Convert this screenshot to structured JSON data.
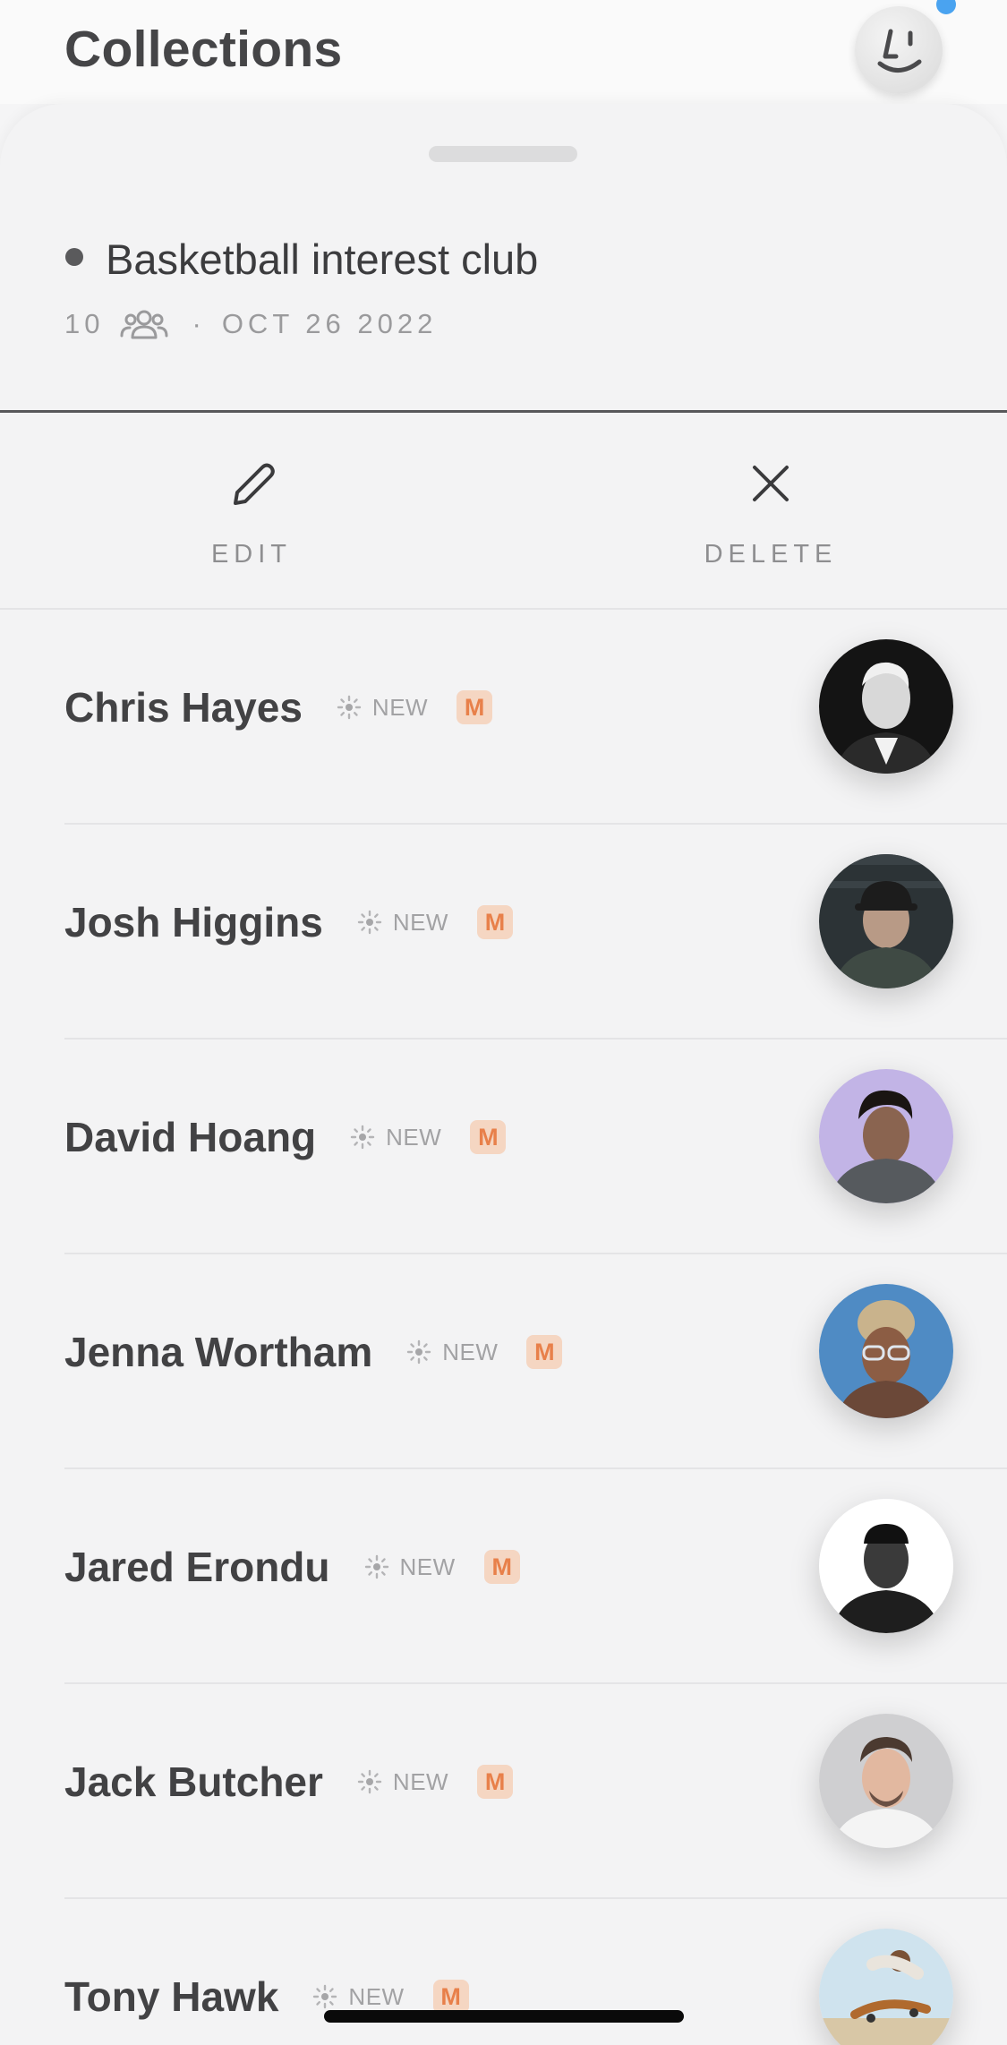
{
  "header": {
    "title": "Collections"
  },
  "collection": {
    "name": "Basketball interest club",
    "member_count": "10",
    "separator": "·",
    "date": "OCT 26 2022"
  },
  "actions": {
    "edit_label": "EDIT",
    "delete_label": "DELETE"
  },
  "people": [
    {
      "name": "Chris Hayes",
      "status": "NEW",
      "badge": "M"
    },
    {
      "name": "Josh Higgins",
      "status": "NEW",
      "badge": "M"
    },
    {
      "name": "David Hoang",
      "status": "NEW",
      "badge": "M"
    },
    {
      "name": "Jenna Wortham",
      "status": "NEW",
      "badge": "M"
    },
    {
      "name": "Jared Erondu",
      "status": "NEW",
      "badge": "M"
    },
    {
      "name": "Jack Butcher",
      "status": "NEW",
      "badge": "M"
    },
    {
      "name": "Tony Hawk",
      "status": "NEW",
      "badge": "M"
    }
  ],
  "colors": {
    "accent_badge_bg": "#f5d6c2",
    "accent_badge_text": "#e8804a",
    "notification_dot": "#4aa3f0"
  },
  "icons": {
    "profile": "smile-face-icon",
    "members": "people-group-icon",
    "edit": "pencil-icon",
    "delete": "close-x-icon",
    "status": "sparkle-icon"
  }
}
